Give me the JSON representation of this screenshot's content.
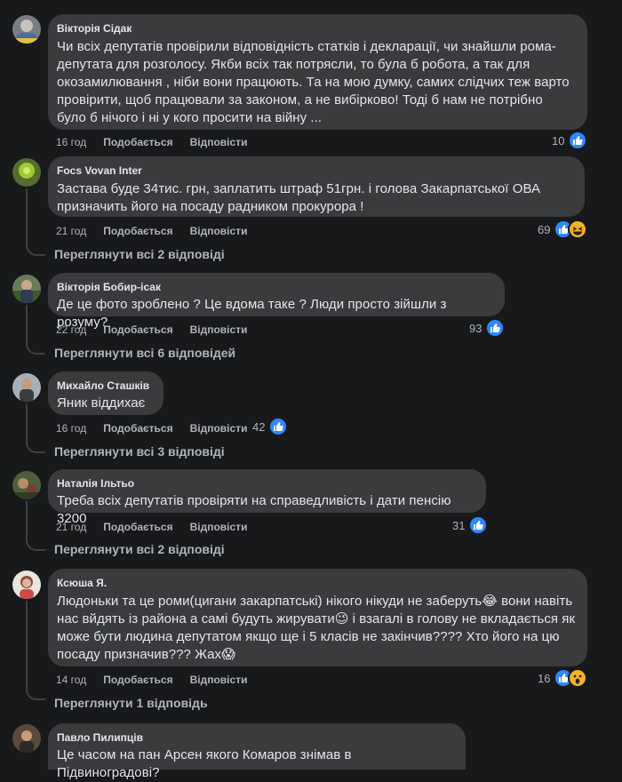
{
  "labels": {
    "like": "Подобається",
    "reply": "Відповісти"
  },
  "comments": [
    {
      "author": "Вікторія Сідак",
      "lines": [
        "Чи всіх депутатів провірили відповідність статків і декларації, чи знайшли рома-",
        "депутата для розголосу. Якби всіх так потрясли, то була б робота, а так для",
        "окозамилювання , ніби вони працюють. Та на мою думку, самих слідчих теж варто",
        "провірити, щоб працювали за законом, а не вибірково! Тоді б нам не потрібно",
        "було б нічого і ні у кого просити на війну ..."
      ],
      "time": "16 год",
      "reactions": "10",
      "reaction_icons": [
        "like"
      ]
    },
    {
      "author": "Focs Vovan Inter",
      "lines": [
        "Застава буде 34тис. грн, заплатить штраф 51грн. і голова Закарпатської ОВА",
        "призначить його на посаду радником прокурора !"
      ],
      "time": "21 год",
      "reactions": "69",
      "reaction_icons": [
        "like",
        "haha"
      ],
      "view_replies": "Переглянути всі 2 відповіді"
    },
    {
      "author": "Вікторія Бобир-ісак",
      "lines": [
        "Де це фото зроблено ? Це вдома таке ? Люди просто зійшли з розуму?"
      ],
      "time": "22 год",
      "reactions": "93",
      "reaction_icons": [
        "like"
      ],
      "view_replies": "Переглянути всі 6 відповідей"
    },
    {
      "author": "Михайло Сташків",
      "lines": [
        "Яник віддихає"
      ],
      "time": "16 год",
      "reactions": "42",
      "reaction_icons": [
        "like"
      ],
      "view_replies": "Переглянути всі 3 відповіді"
    },
    {
      "author": "Наталія Ільтьо",
      "lines": [
        "Треба всіх депутатів провіряти на справедливість і дати пенсію 3200"
      ],
      "time": "21 год",
      "reactions": "31",
      "reaction_icons": [
        "like"
      ],
      "view_replies": "Переглянути всі 2 відповіді"
    },
    {
      "author": "Ксюша Я.",
      "lines": [
        "Людоньки та це роми(цигани закарпатські) нікого нікуди не заберуть😂 вони навіть",
        "нас вйдять із района а самі будуть жирувати😉 і взагалі в голову не вкладається як",
        "може бути людина депутатом якщо ще і 5 класів не закінчив???? Хто його на цю",
        "посаду призначив??? Жах😱"
      ],
      "time": "14 год",
      "reactions": "16",
      "reaction_icons": [
        "like",
        "wow"
      ],
      "view_replies": "Переглянути 1 відповідь"
    },
    {
      "author": "Павло Пилипців",
      "lines": [
        "Це часом на пан Арсен якого Комаров знімав в Підвиноградові?"
      ]
    }
  ]
}
